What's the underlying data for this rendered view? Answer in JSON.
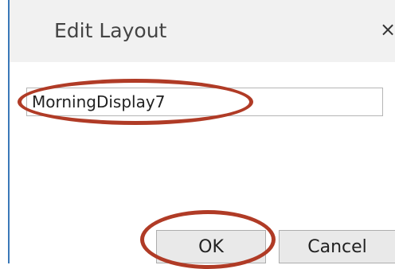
{
  "dialog": {
    "title": "Edit Layout",
    "close_icon": "close-icon",
    "close_glyph": "×",
    "name_input": {
      "value": "MorningDisplay7",
      "placeholder": ""
    },
    "ok_label": "OK",
    "cancel_label": "Cancel"
  },
  "annotations": {
    "highlight_color": "#b03b26",
    "highlighted": [
      "name-input",
      "ok-button"
    ]
  },
  "colors": {
    "titlebar_bg": "#f1f1f1",
    "window_border": "#3a78b8",
    "button_bg": "#e9e9e9"
  }
}
